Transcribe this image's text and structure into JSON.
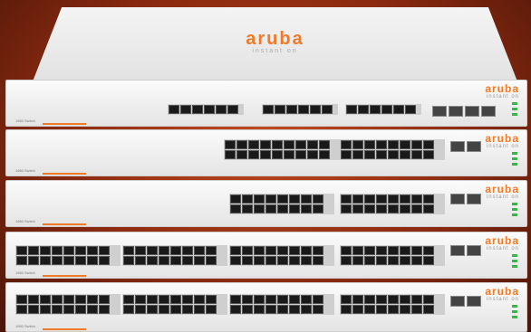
{
  "product": {
    "brand": "aruba",
    "sub_brand": "instant on",
    "colors": {
      "brand_orange": "#f07a28",
      "led_green": "#3bb54a"
    }
  },
  "units": [
    {
      "model": "1960 Switch"
    },
    {
      "model": "1960 Switch"
    },
    {
      "model": "1960 Switch"
    },
    {
      "model": "1960 Switch"
    },
    {
      "model": "1960 Switch"
    }
  ]
}
